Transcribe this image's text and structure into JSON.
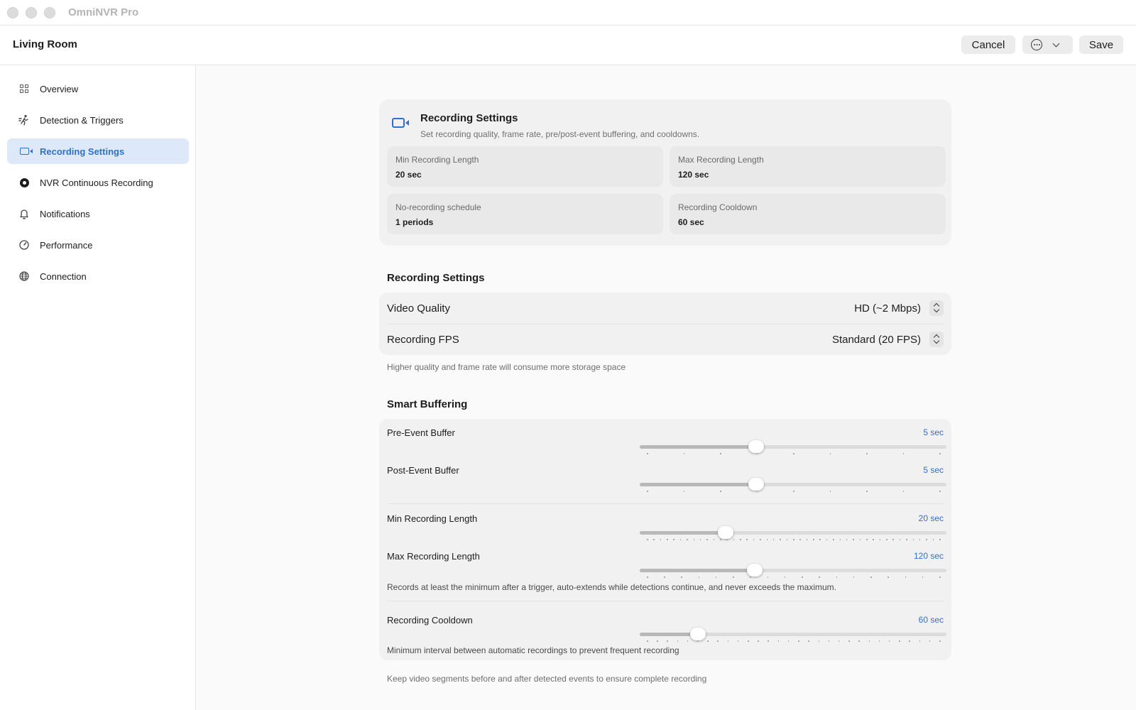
{
  "window": {
    "title": "OmniNVR Pro"
  },
  "toolbar": {
    "page_title": "Living Room",
    "cancel_label": "Cancel",
    "save_label": "Save"
  },
  "sidebar": {
    "items": [
      {
        "label": "Overview",
        "icon": "grid-icon",
        "active": false
      },
      {
        "label": "Detection & Triggers",
        "icon": "running-person-icon",
        "active": false
      },
      {
        "label": "Recording Settings",
        "icon": "video-camera-icon",
        "active": true
      },
      {
        "label": "NVR Continuous Recording",
        "icon": "record-icon",
        "active": false
      },
      {
        "label": "Notifications",
        "icon": "bell-icon",
        "active": false
      },
      {
        "label": "Performance",
        "icon": "gauge-icon",
        "active": false
      },
      {
        "label": "Connection",
        "icon": "globe-icon",
        "active": false
      }
    ]
  },
  "summary": {
    "title": "Recording Settings",
    "subtitle": "Set recording quality, frame rate, pre/post-event buffering, and cooldowns.",
    "stats": [
      {
        "label": "Min Recording Length",
        "value": "20 sec"
      },
      {
        "label": "Max Recording Length",
        "value": "120 sec"
      },
      {
        "label": "No-recording schedule",
        "value": "1 periods"
      },
      {
        "label": "Recording Cooldown",
        "value": "60 sec"
      }
    ]
  },
  "recording": {
    "section_title": "Recording Settings",
    "video_quality": {
      "label": "Video Quality",
      "value": "HD (~2 Mbps)"
    },
    "fps": {
      "label": "Recording FPS",
      "value": "Standard (20 FPS)"
    },
    "footnote": "Higher quality and frame rate will consume more storage space"
  },
  "buffering": {
    "section_title": "Smart Buffering",
    "sliders": [
      {
        "key": "pre",
        "label": "Pre-Event Buffer",
        "value": "5 sec",
        "fraction": 0.38,
        "tick_count": 9
      },
      {
        "key": "post",
        "label": "Post-Event Buffer",
        "value": "5 sec",
        "fraction": 0.38,
        "tick_count": 9
      },
      {
        "key": "min",
        "label": "Min Recording Length",
        "value": "20 sec",
        "fraction": 0.28,
        "tick_count": 45
      },
      {
        "key": "max",
        "label": "Max Recording Length",
        "value": "120 sec",
        "fraction": 0.375,
        "tick_count": 18
      },
      {
        "key": "cooldown",
        "label": "Recording Cooldown",
        "value": "60 sec",
        "fraction": 0.19,
        "tick_count": 30
      }
    ],
    "length_help": "Records at least the minimum after a trigger, auto-extends while detections continue, and never exceeds the maximum.",
    "cooldown_help": "Minimum interval between automatic recordings to prevent frequent recording",
    "footnote": "Keep video segments before and after detected events to ensure complete recording"
  },
  "colors": {
    "accent": "#2f6fd0",
    "active_bg": "#dde8f8"
  }
}
